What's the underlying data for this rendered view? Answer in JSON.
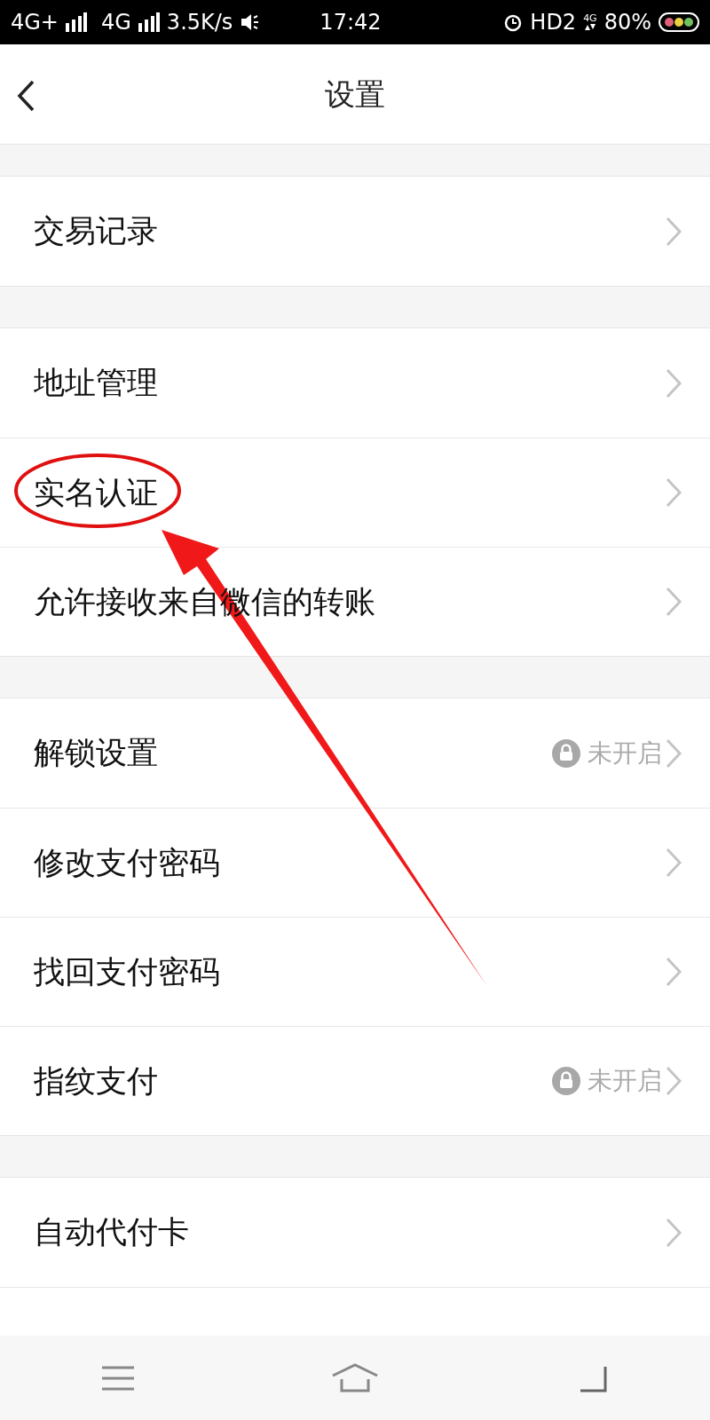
{
  "status_bar": {
    "sim1": "4G+",
    "sim2": "4G",
    "speed": "3.5K/s",
    "time": "17:42",
    "hd": "HD2",
    "net": "4G",
    "battery": "80%"
  },
  "header": {
    "title": "设置"
  },
  "sections": [
    [
      {
        "label": "交易记录"
      }
    ],
    [
      {
        "label": "地址管理"
      },
      {
        "label": "实名认证"
      },
      {
        "label": "允许接收来自微信的转账"
      }
    ],
    [
      {
        "label": "解锁设置",
        "status": "未开启"
      },
      {
        "label": "修改支付密码"
      },
      {
        "label": "找回支付密码"
      },
      {
        "label": "指纹支付",
        "status": "未开启"
      }
    ],
    [
      {
        "label": "自动代付卡"
      }
    ]
  ]
}
